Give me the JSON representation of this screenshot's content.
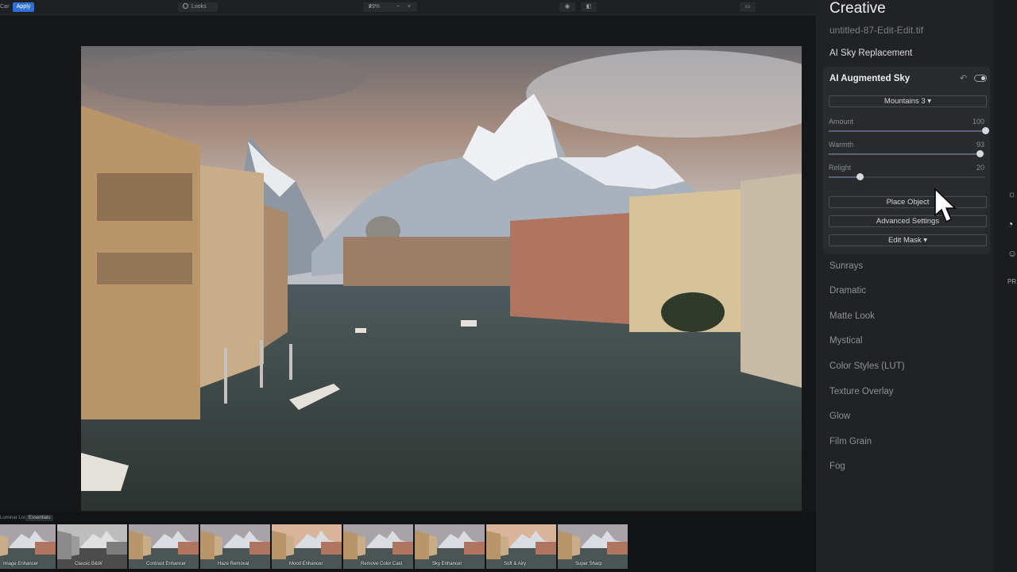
{
  "toolbar": {
    "cancel_label": "Cancel",
    "apply_label": "Apply",
    "looks_label": "Looks",
    "zoom_value": "29%",
    "zoom_out": "−",
    "zoom_in": "+"
  },
  "filmstrip": {
    "label": "Luminar Looks:",
    "collection": "Essentials",
    "thumbs": [
      {
        "label": "Image Enhancer",
        "style": "color"
      },
      {
        "label": "Classic B&W",
        "style": "bw"
      },
      {
        "label": "Contrast Enhancer",
        "style": "color"
      },
      {
        "label": "Haze Removal",
        "style": "color"
      },
      {
        "label": "Mood Enhancer",
        "style": "warm"
      },
      {
        "label": "Remove Color Cast",
        "style": "color"
      },
      {
        "label": "Sky Enhancer",
        "style": "color"
      },
      {
        "label": "Soft & Airy",
        "style": "warm"
      },
      {
        "label": "Super Sharp",
        "style": "color"
      }
    ]
  },
  "panel": {
    "title": "Creative",
    "filename": "untitled-87-Edit-Edit.tif",
    "active_section_above": "AI Sky Replacement",
    "card": {
      "title": "AI Augmented Sky",
      "preset": "Mountains 3 ▾",
      "sliders": [
        {
          "label": "Amount",
          "value": "100",
          "level": 1.0
        },
        {
          "label": "Warmth",
          "value": "93",
          "level": 0.965
        },
        {
          "label": "Relight",
          "value": "20",
          "level": 0.2
        }
      ],
      "place_object": "Place Object",
      "advanced_settings": "Advanced Settings",
      "edit_mask": "Edit Mask ▾"
    },
    "sections": [
      "Sunrays",
      "Dramatic",
      "Matte Look",
      "Mystical",
      "Color Styles (LUT)",
      "Texture Overlay",
      "Glow",
      "Film Grain",
      "Fog"
    ]
  },
  "colors": {
    "accent": "#2f6fd6",
    "panel_bg": "#212225",
    "card_bg": "#2a2b2e"
  }
}
